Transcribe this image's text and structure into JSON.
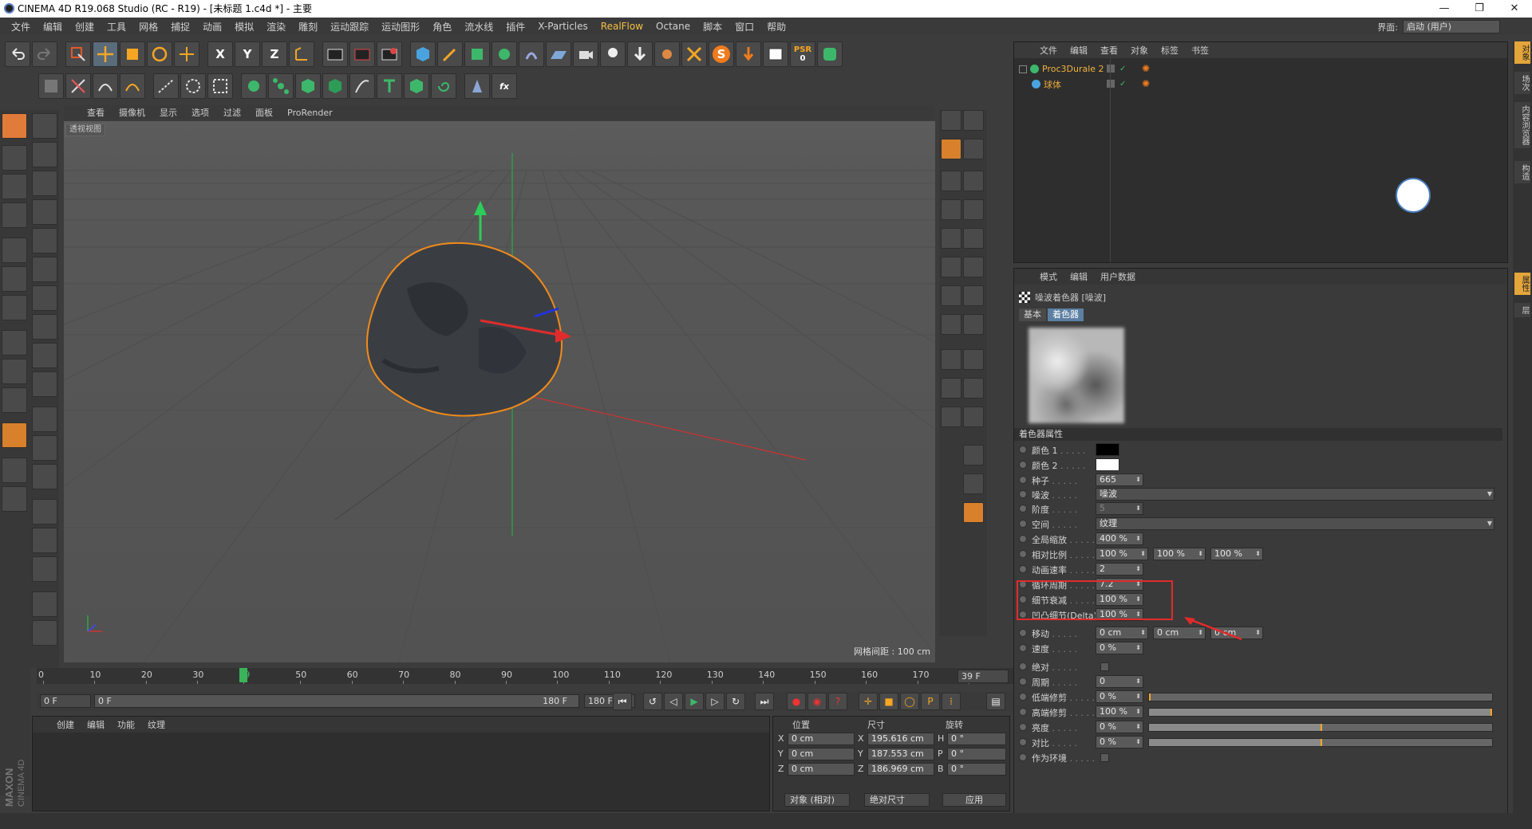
{
  "window": {
    "title": "CINEMA 4D R19.068 Studio (RC - R19) - [未标题 1.c4d *] - 主要",
    "controls": [
      "—",
      "❐",
      "✕"
    ]
  },
  "menubar": {
    "items": [
      "文件",
      "编辑",
      "创建",
      "工具",
      "网格",
      "捕捉",
      "动画",
      "模拟",
      "渲染",
      "雕刻",
      "运动跟踪",
      "运动图形",
      "角色",
      "流水线",
      "插件",
      "X-Particles",
      "RealFlow",
      "Octane",
      "脚本",
      "窗口",
      "帮助"
    ],
    "highlight_index": 16,
    "layout_label": "界面:",
    "layout_value": "启动 (用户)"
  },
  "toolbar": {
    "axis_x": "X",
    "axis_y": "Y",
    "axis_z": "Z",
    "psr_label": "PSR",
    "psr_value": "0",
    "s_label": "S"
  },
  "viewport": {
    "menu": [
      "查看",
      "摄像机",
      "显示",
      "选项",
      "过滤",
      "面板",
      "ProRender"
    ],
    "label": "透视视图",
    "grid_info": "网格间距 : 100 cm"
  },
  "object_manager": {
    "menu": [
      "文件",
      "编辑",
      "查看",
      "对象",
      "标签",
      "书签"
    ],
    "objects": [
      {
        "name": "Proc3Durale 2"
      },
      {
        "name": "球体"
      }
    ]
  },
  "attribute_manager": {
    "menu": [
      "模式",
      "编辑",
      "用户数据"
    ],
    "shader_title": "噪波着色器 [噪波]",
    "tabs": [
      "基本",
      "着色器"
    ],
    "active_tab": 1,
    "section": "着色器属性",
    "props": {
      "color1": {
        "label": "颜色 1",
        "value": "#000000"
      },
      "color2": {
        "label": "颜色 2",
        "value": "#ffffff"
      },
      "seed": {
        "label": "种子",
        "value": "665"
      },
      "noise": {
        "label": "噪波",
        "value": "噪波"
      },
      "octaves": {
        "label": "阶度",
        "value": "5"
      },
      "space": {
        "label": "空间",
        "value": "纹理"
      },
      "global_scale": {
        "label": "全局缩放",
        "value": "400 %"
      },
      "relative_scale": {
        "label": "相对比例",
        "values": [
          "100 %",
          "100 %",
          "100 %"
        ]
      },
      "anim_speed": {
        "label": "动画速率",
        "value": "2"
      },
      "loop_period": {
        "label": "循环周期",
        "value": "7.2"
      },
      "detail_atten": {
        "label": "细节衰减",
        "value": "100 %"
      },
      "delta": {
        "label": "凹凸细节(Delta)",
        "value": "100 %"
      },
      "move": {
        "label": "移动",
        "values": [
          "0 cm",
          "0 cm",
          "0 cm"
        ]
      },
      "speed": {
        "label": "速度",
        "value": "0 %"
      },
      "absolute": {
        "label": "绝对"
      },
      "period": {
        "label": "周期",
        "value": "0"
      },
      "low_clip": {
        "label": "低端修剪",
        "value": "0 %",
        "fill": 0.0
      },
      "high_clip": {
        "label": "高端修剪",
        "value": "100 %",
        "fill": 1.0
      },
      "brightness": {
        "label": "亮度",
        "value": "0 %",
        "fill": 0.5
      },
      "contrast": {
        "label": "对比",
        "value": "0 %",
        "fill": 0.5
      },
      "as_env": {
        "label": "作为环境"
      }
    }
  },
  "timeline": {
    "ticks": [
      "0",
      "10",
      "20",
      "30",
      "39",
      "50",
      "60",
      "70",
      "80",
      "90",
      "100",
      "110",
      "120",
      "130",
      "140",
      "150",
      "160",
      "170",
      "180"
    ],
    "current": 39,
    "frame_field": "39 F",
    "start_field": "0 F",
    "range_start": "0 F",
    "range_end": "180 F",
    "end_field": "180 F"
  },
  "material_manager": {
    "menu": [
      "创建",
      "编辑",
      "功能",
      "纹理"
    ]
  },
  "coordinates": {
    "headers": [
      "位置",
      "尺寸",
      "旋转"
    ],
    "rows": [
      {
        "axis": "X",
        "pos": "0 cm",
        "size_axis": "X",
        "size": "195.616 cm",
        "rot_axis": "H",
        "rot": "0 °"
      },
      {
        "axis": "Y",
        "pos": "0 cm",
        "size_axis": "Y",
        "size": "187.553 cm",
        "rot_axis": "P",
        "rot": "0 °"
      },
      {
        "axis": "Z",
        "pos": "0 cm",
        "size_axis": "Z",
        "size": "186.969 cm",
        "rot_axis": "B",
        "rot": "0 °"
      }
    ],
    "mode": "对象 (相对)",
    "size_mode": "绝对尺寸",
    "apply": "应用"
  },
  "maxon": {
    "line1": "MAXON",
    "line2": "CINEMA 4D"
  },
  "side_tabs": [
    "对象",
    "场次",
    "内容浏览器",
    "构造",
    "属性",
    "层"
  ]
}
